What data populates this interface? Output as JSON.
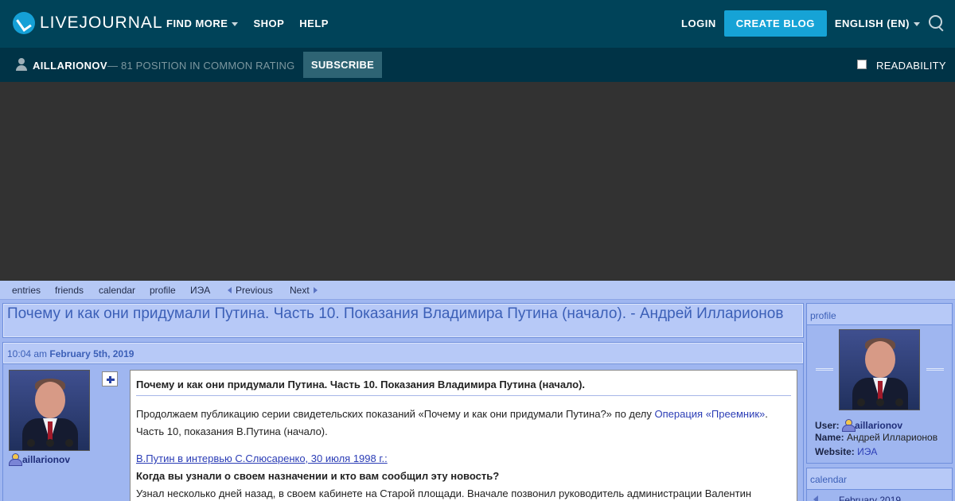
{
  "topbar": {
    "logo_text": "LIVEJOURNAL",
    "nav": [
      {
        "label": "FIND MORE",
        "dropdown": true
      },
      {
        "label": "SHOP",
        "dropdown": false
      },
      {
        "label": "HELP",
        "dropdown": false
      }
    ],
    "login_label": "LOGIN",
    "create_blog_label": "CREATE BLOG",
    "language_label": "ENGLISH (EN)"
  },
  "userbar": {
    "username": "AILLARIONOV",
    "rating_text": "— 81 POSITION IN COMMON RATING",
    "subscribe_label": "SUBSCRIBE",
    "readability_label": "READABILITY",
    "readability_checked": false
  },
  "journal_nav": {
    "entries": "entries",
    "friends": "friends",
    "calendar": "calendar",
    "profile": "profile",
    "iea": "ИЭА",
    "previous": "Previous",
    "next": "Next"
  },
  "entry": {
    "page_title": "Почему и как они придумали Путина. Часть 10. Показания Владимира Путина (начало). - Андрей Илларионов",
    "time": "10:04 am",
    "date": "February 5th, 2019",
    "poster": "aillarionov",
    "heading": "Почему и как они придумали Путина. Часть 10. Показания Владимира Путина (начало).",
    "intro_prefix": "Продолжаем публикацию серии свидетельских показаний «Почему и как они придумали Путина?» по делу ",
    "intro_link": "Операция «Преемник»",
    "intro_suffix": ".",
    "intro_line2": "Часть 10, показания В.Путина (начало).",
    "source_link": "В.Путин в интервью С.Слюсаренко, 30 июля 1998 г.:",
    "question": "Когда вы узнали о своем назначении и кто вам сообщил эту новость?",
    "answer_start": "Узнал несколько дней назад, в своем кабинете на Старой площади. Вначале позвонил руководитель администрации Валентин"
  },
  "sidebar": {
    "profile_title": "profile",
    "user_label": "User:",
    "user_value": "aillarionov",
    "name_label": "Name:",
    "name_value": "Андрей Илларионов",
    "website_label": "Website:",
    "website_value": "ИЭА",
    "calendar_title": "calendar",
    "calendar_month": "February 2019"
  },
  "colors": {
    "topbar_bg": "#004359",
    "userbar_bg": "#003346",
    "accent": "#16a3d6",
    "page_bg": "#9fb6f0",
    "title_text": "#3b5fb7"
  }
}
